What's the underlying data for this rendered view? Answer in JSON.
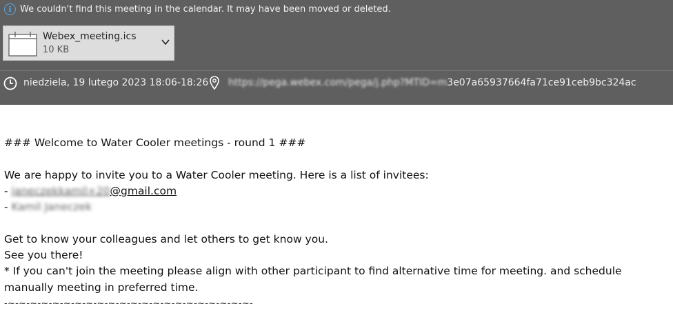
{
  "notice": {
    "icon": "info-icon",
    "text": "We couldn't find this meeting in the calendar. It may have been moved or deleted."
  },
  "attachment": {
    "icon": "calendar-file-icon",
    "name": "Webex_meeting.ics",
    "size": "10 KB"
  },
  "meeting": {
    "when": "niedziela, 19 lutego 2023 18:06-18:26",
    "location_obscured": "https://pega.webex.com/pega/j.php?MTID=m",
    "location_visible": "3e07a65937664fa71ce91ceb9bc324ac"
  },
  "body": {
    "heading": "### Welcome to Water Cooler meetings - round 1 ###",
    "invite_line": "We are happy to invite you to a Water Cooler meeting. Here is a list of invitees:",
    "invitee_prefix": "- ",
    "invitee1_obscured": "janeczekkamil+20",
    "invitee1_domain": "@gmail.com",
    "invitee2_obscured": "Kamil Janeczek",
    "line_know": "Get to know your colleagues and let others to get know you.",
    "line_see": "See you there!",
    "line_note": "* If you can't join the meeting please align with other participant to find alternative time for meeting. and schedule manually meeting in preferred time.",
    "signature": "-~-~-~-~-~-~-~-~-~-~-~-~-~-~-~-~-~-~-~-~-~-~-"
  }
}
